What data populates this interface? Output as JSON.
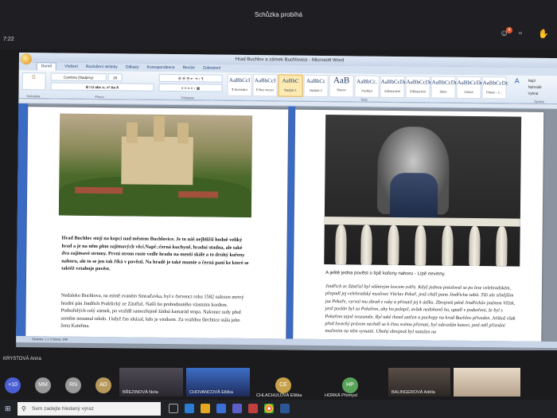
{
  "meeting": {
    "title": "Schůzka probíhá",
    "clock": "7:22",
    "badge": "4"
  },
  "word": {
    "window_title": "Hrad Buchlov a zámek Buchlovice - Microsoft Word",
    "tabs": [
      "Domů",
      "Vložení",
      "Rozložení stránky",
      "Odkazy",
      "Korespondence",
      "Revize",
      "Zobrazení"
    ],
    "font_name": "Cambria (Nadpisy)",
    "font_size": "28",
    "styles": [
      {
        "sample": "AaBbCcI",
        "name": "¶ Normální"
      },
      {
        "sample": "AaBbCcI",
        "name": "¶ Bez mezer"
      },
      {
        "sample": "AaBbC",
        "name": "Nadpis 1"
      },
      {
        "sample": "AaBbCc",
        "name": "Nadpis 2"
      },
      {
        "sample": "AaB",
        "name": "Název"
      },
      {
        "sample": "AaBbCc.",
        "name": "Podtitul"
      },
      {
        "sample": "AaBbCcDc",
        "name": "Zdůraznění"
      },
      {
        "sample": "AaBbCcDc",
        "name": "Zdůraznění"
      },
      {
        "sample": "AaBbCcDc",
        "name": "Silné"
      },
      {
        "sample": "AaBbCcDc",
        "name": "Citace"
      },
      {
        "sample": "AaBbCcDc",
        "name": "Citace - z..."
      }
    ],
    "ribbon_groups": [
      "Schránka",
      "Písmo",
      "Odstavec",
      "Styly",
      "Úpravy"
    ],
    "find_label": "Najít",
    "replace_label": "Nahradit",
    "select_label": "Vybrat",
    "status": "Stránka: 1 z 3   Slova: 349"
  },
  "left_page": {
    "bold_paragraph": "Hrad Buchlov stojí na kopci nad městem Buchlovice. Je to náš nejbližší hodně veliký hrad a je na něm plno zajímavých věcí.Např.:černá kuchyně, hradní studna, ale také dva zajímavé stromy. První strom roste vedle hradu na menší skále a to druhý kořeny nahoru, ale to se jen tak říká v pověsti. Na hradě je také mumie a černá paní ke které se taktéž vztahuje pověst.",
    "plain_paragraph": "Nedaleko Buchlova, na místě zvaném Smraďavka, byl v červenci roku 1582 nalezen mrtvý hradní pán Jindřich Prakšický ze Zástřizl. Našli ho probodnutého vlastním kordem. Podezřelých celý zámek, po vraždě samozřejmě žádná kamarád stopa. Nakonec tedy před zeměm nestanul nikdo. I když čas ukázal, kdo je viníkem. Za vraždou šlechtice stála jeho žena Kateřina."
  },
  "right_page": {
    "caption": "A ještě jedna pověst o lípě kořeny nahoru - Lípě nevinny.",
    "italic_paragraph": "Jindřich ze Zástřizl byl vášnivým lovcem zvěře. Když jednou potuloval se po lese velehradském, přepadl jej velehradský myslivec Václav Pekař, jenž chtěl pana Jindřicha zabít. Tiží ale silnějším jsa Pekaře, vyrval mu zbraň z ruky a přinutil jej k útěku. Zbrojnoš páně Jindřichův jménem Vlček, jenž poslán byl za Pekařem, aby ho polapil, avšak nedohonil ho, upadl v podezření, že byl s Pekařem tajně srozuměn. Byl také ihned zatčen a pochopy na hrad Buchlov přiveden. Jelikož však před lovecký právem nechtěl se k činu svému přiznati, byl odevzdán katovi, jenž měl přiznání mučením na něm vynutiti. Ubohý zbrojnoš byl natažen na"
  },
  "participants": {
    "presenter": "KRYSTOVÁ Anna",
    "overflow": "+10",
    "avatars": [
      {
        "initials": "MM",
        "color": "#9a9a9a"
      },
      {
        "initials": "RN",
        "color": "#9a9a9a"
      },
      {
        "initials": "AD",
        "color": "#b79a5b"
      }
    ],
    "tiles": [
      {
        "name": "BŘEZINOVÁ Nela"
      },
      {
        "name": "CHOVANCOVÁ Eliška"
      },
      {
        "name": "CHLACHULOVÁ Eliška"
      },
      {
        "name": "HORKÁ Přemysl"
      },
      {
        "name": "BALINGEROVÁ Adéla"
      }
    ],
    "mid_avatars": [
      {
        "initials": "CE",
        "color": "#c7a24a"
      },
      {
        "initials": "HP",
        "color": "#5aa35a"
      }
    ]
  },
  "taskbar": {
    "search_placeholder": "Sem zadejte hledaný výraz"
  }
}
